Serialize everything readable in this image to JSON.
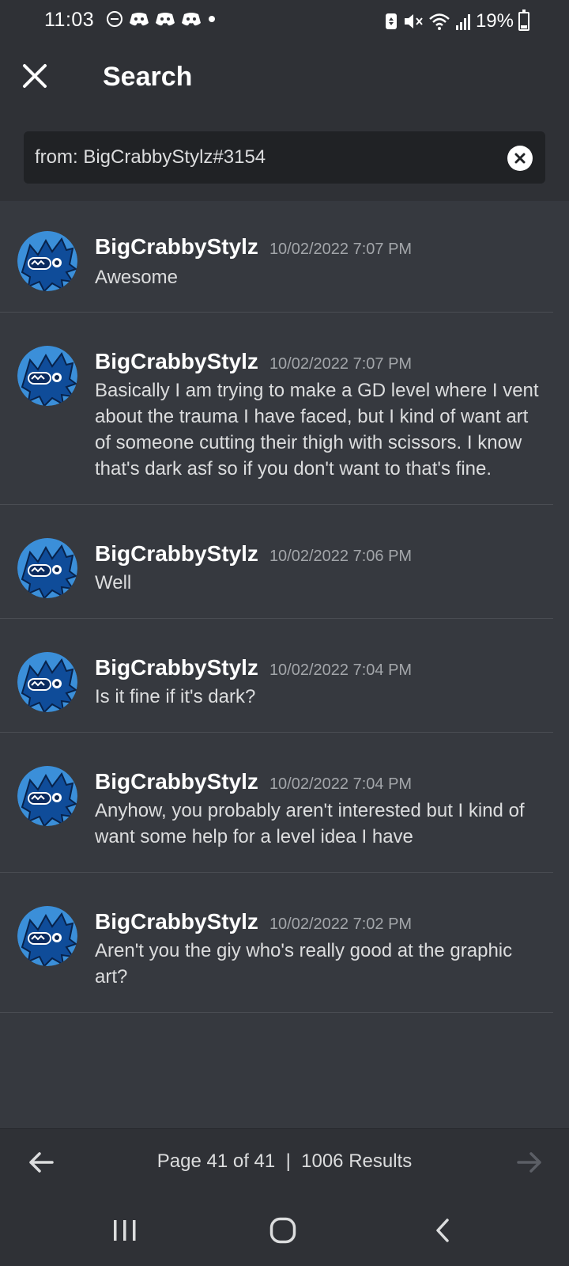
{
  "status_bar": {
    "time": "11:03",
    "battery": "19%"
  },
  "header": {
    "title": "Search"
  },
  "search": {
    "value": "from: BigCrabbyStylz#3154"
  },
  "results": [
    {
      "username": "BigCrabbyStylz",
      "timestamp": "10/02/2022 7:07 PM",
      "text": "Awesome"
    },
    {
      "username": "BigCrabbyStylz",
      "timestamp": "10/02/2022 7:07 PM",
      "text": "Basically I am trying to make a GD level where I vent about the trauma I have faced, but I kind of want art of someone cutting their thigh with scissors. I know that's dark asf so if you don't want to that's fine."
    },
    {
      "username": "BigCrabbyStylz",
      "timestamp": "10/02/2022 7:06 PM",
      "text": "Well"
    },
    {
      "username": "BigCrabbyStylz",
      "timestamp": "10/02/2022 7:04 PM",
      "text": "Is it fine if it's dark?"
    },
    {
      "username": "BigCrabbyStylz",
      "timestamp": "10/02/2022 7:04 PM",
      "text": "Anyhow, you probably aren't interested but I kind of want some help for a level idea I have"
    },
    {
      "username": "BigCrabbyStylz",
      "timestamp": "10/02/2022 7:02 PM",
      "text": "Aren't you the giy who's really good at the graphic art?"
    }
  ],
  "footer": {
    "pagination": "Page 41 of 41  |  1006 Results"
  },
  "colors": {
    "background": "#36393f",
    "header": "#2f3136",
    "input": "#202225",
    "avatar_blue": "#1e6fc0"
  }
}
